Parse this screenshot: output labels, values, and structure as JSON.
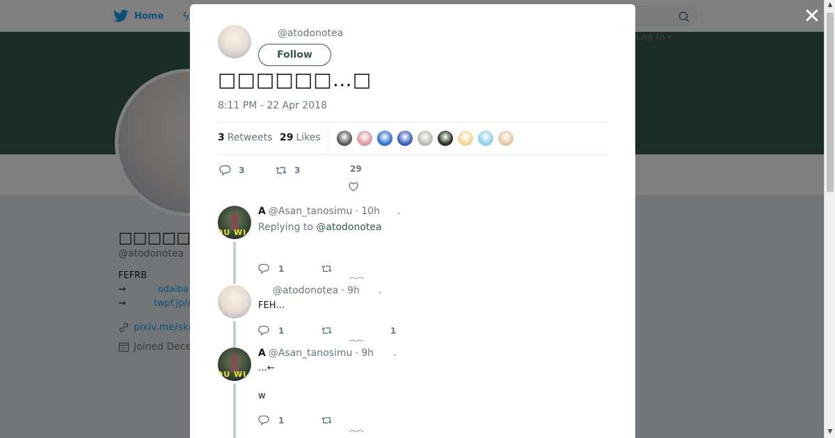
{
  "nav": {
    "home_label": "Home",
    "login_label": "Log in ▾"
  },
  "profile": {
    "name": "□□□□□",
    "handle": "@atodonotea",
    "bio_line1": "FEFRB",
    "bio_line2_arrow": "→",
    "bio_line2_link": "odaiba",
    "bio_line3_arrow": "→",
    "bio_line3_link": "twpf.jp/a",
    "website": "pixiv.me/ski",
    "joined": "Joined Dece"
  },
  "tweet": {
    "handle": "@atodonotea",
    "follow_label": "Follow",
    "text": "□□□□□□…□",
    "timestamp": "8:11 PM - 22 Apr 2018",
    "retweets_count": "3",
    "retweets_label": "Retweets",
    "likes_count": "29",
    "likes_label": "Likes",
    "reply_count": "3",
    "retweet_count": "3",
    "like_count": "29"
  },
  "likers": [
    {
      "color": "#5a5a5a"
    },
    {
      "color": "#d99aa0"
    },
    {
      "color": "#2f6fd0"
    },
    {
      "color": "#3b5fb8"
    },
    {
      "color": "#b8bbb0"
    },
    {
      "color": "#243322"
    },
    {
      "color": "#f1d59b"
    },
    {
      "color": "#8fd2ec"
    },
    {
      "color": "#e3c7a8"
    }
  ],
  "replies": [
    {
      "name": "A",
      "handle": "@Asan_tanosimu",
      "time": "· 10h",
      "replying_prefix": "Replying to",
      "replying_handle": "@atodonotea",
      "reply_count": "1",
      "avatar_text": "OU WI"
    },
    {
      "name": "",
      "handle": "@atodonotea",
      "time": "· 9h",
      "body": "FEH…",
      "reply_count": "1",
      "like_count": "1"
    },
    {
      "name": "A",
      "handle": "@Asan_tanosimu",
      "time": "· 9h",
      "body1": "…←",
      "body2": "w",
      "reply_count": "1",
      "avatar_text": "OU WI"
    }
  ],
  "colors": {
    "banner": "#34584a",
    "accent": "#34584a",
    "twitter_blue": "#1da1f2"
  }
}
